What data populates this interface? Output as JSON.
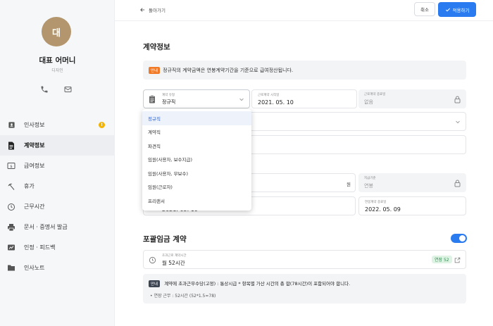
{
  "profile": {
    "avatar_char": "대",
    "name": "대표 어머니",
    "role": "디자인"
  },
  "sidebar": {
    "items": [
      {
        "label": "인사정보",
        "icon": "person-card-icon",
        "badge": "!"
      },
      {
        "label": "계약정보",
        "icon": "document-icon",
        "active": true
      },
      {
        "label": "급여정보",
        "icon": "money-icon"
      },
      {
        "label": "휴가",
        "icon": "beach-umbrella-icon"
      },
      {
        "label": "근무시간",
        "icon": "clock-icon"
      },
      {
        "label": "문서 · 증명서 발급",
        "icon": "printer-icon"
      },
      {
        "label": "인정 · 피드백",
        "icon": "feedback-icon"
      },
      {
        "label": "인사노트",
        "icon": "folder-icon"
      }
    ]
  },
  "topbar": {
    "back_label": "돌아가기",
    "cancel_label": "취소",
    "apply_label": "적용하기"
  },
  "contract": {
    "title": "계약정보",
    "notice_tag": "안내",
    "notice_text": "정규직의 계약금액은 연봉계약기간을 기준으로 급여정산됩니다.",
    "type_field": {
      "label": "계약 유형",
      "value": "정규직"
    },
    "start_field": {
      "label": "근로계약 시작일",
      "value": "2021. 05. 10"
    },
    "end_field": {
      "label": "근로계약 종료일",
      "value": "없음"
    },
    "unit_char": "원",
    "pay_period_field": {
      "label": "지급기준",
      "value": "연봉"
    },
    "hidden_start_value": "2021. 05. 10",
    "salary_end_field": {
      "label": "연봉계약 종료일",
      "value": "2022. 05. 09"
    }
  },
  "dropdown": {
    "options": [
      "정규직",
      "계약직",
      "파견직",
      "임원(사용자, 보수지급)",
      "임원(사용자, 무보수)",
      "임원(근로자)",
      "프리랜서"
    ],
    "selected": "정규직"
  },
  "overtime": {
    "title": "포괄임금 계약",
    "toggle_on": true,
    "hours_field": {
      "label": "초과근로 계약시간",
      "value": "월 52시간"
    },
    "pill": "연장 52",
    "info_tag": "안내",
    "info_text": "계약에 초과근무수당(고정) : 통상시급 * 항목별 가산 시간의 총 합(78시간)이 포함되어야 합니다.",
    "info_detail": "• 연장 근무 : 52시간 (52*1.5=78)"
  },
  "colors": {
    "accent": "#2b7bf0",
    "avatar_bg": "#b3966d",
    "notice_tag": "#f07a28",
    "info_tag": "#3d4452",
    "badge": "#f5b400",
    "pill_bg": "#dff3e5",
    "pill_text": "#2b8a4b"
  }
}
